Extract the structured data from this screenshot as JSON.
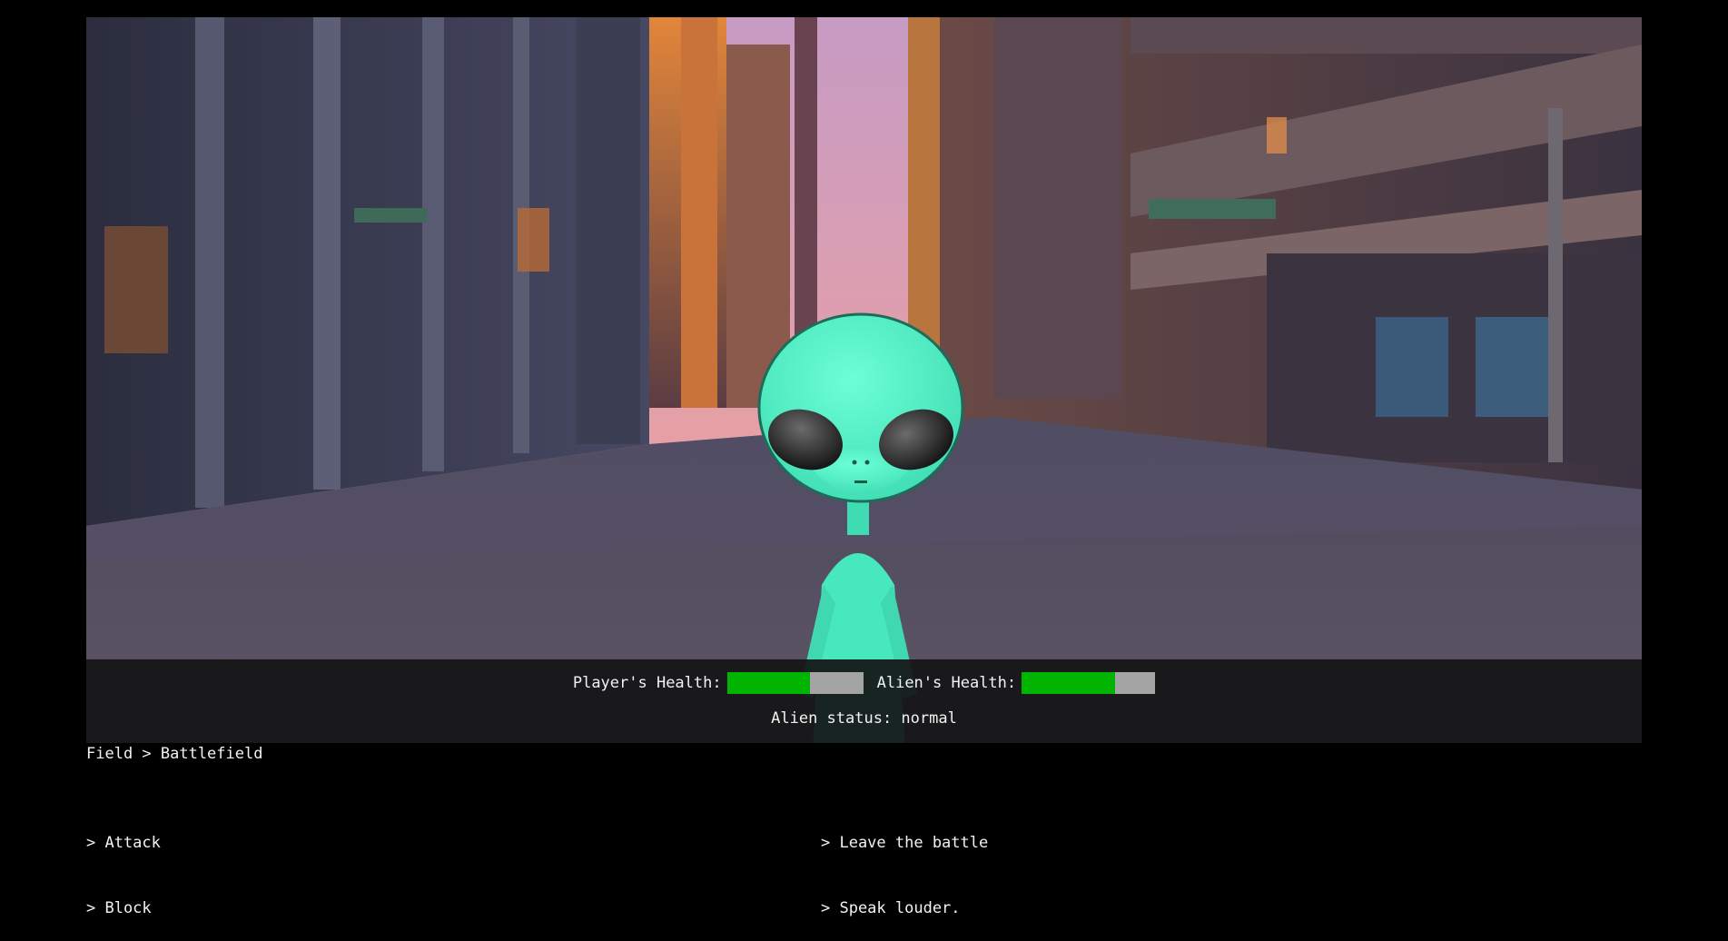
{
  "hud": {
    "player_health_label": "Player's Health:",
    "player_health_fraction": 0.61,
    "alien_health_label": "Alien's Health:",
    "alien_health_fraction": 0.7,
    "alien_status": "Alien status: normal"
  },
  "location": "Field > Battlefield",
  "actions_left": [
    "> Attack",
    "> Block"
  ],
  "actions_right": [
    "> Leave the battle",
    "> Speak louder."
  ],
  "colors": {
    "health_fill": "#00b400",
    "health_empty": "#a4a4a4",
    "alien_skin": "#4af2c4"
  },
  "icons": {
    "scene": "pixel-art-city-street",
    "enemy": "green-alien"
  }
}
